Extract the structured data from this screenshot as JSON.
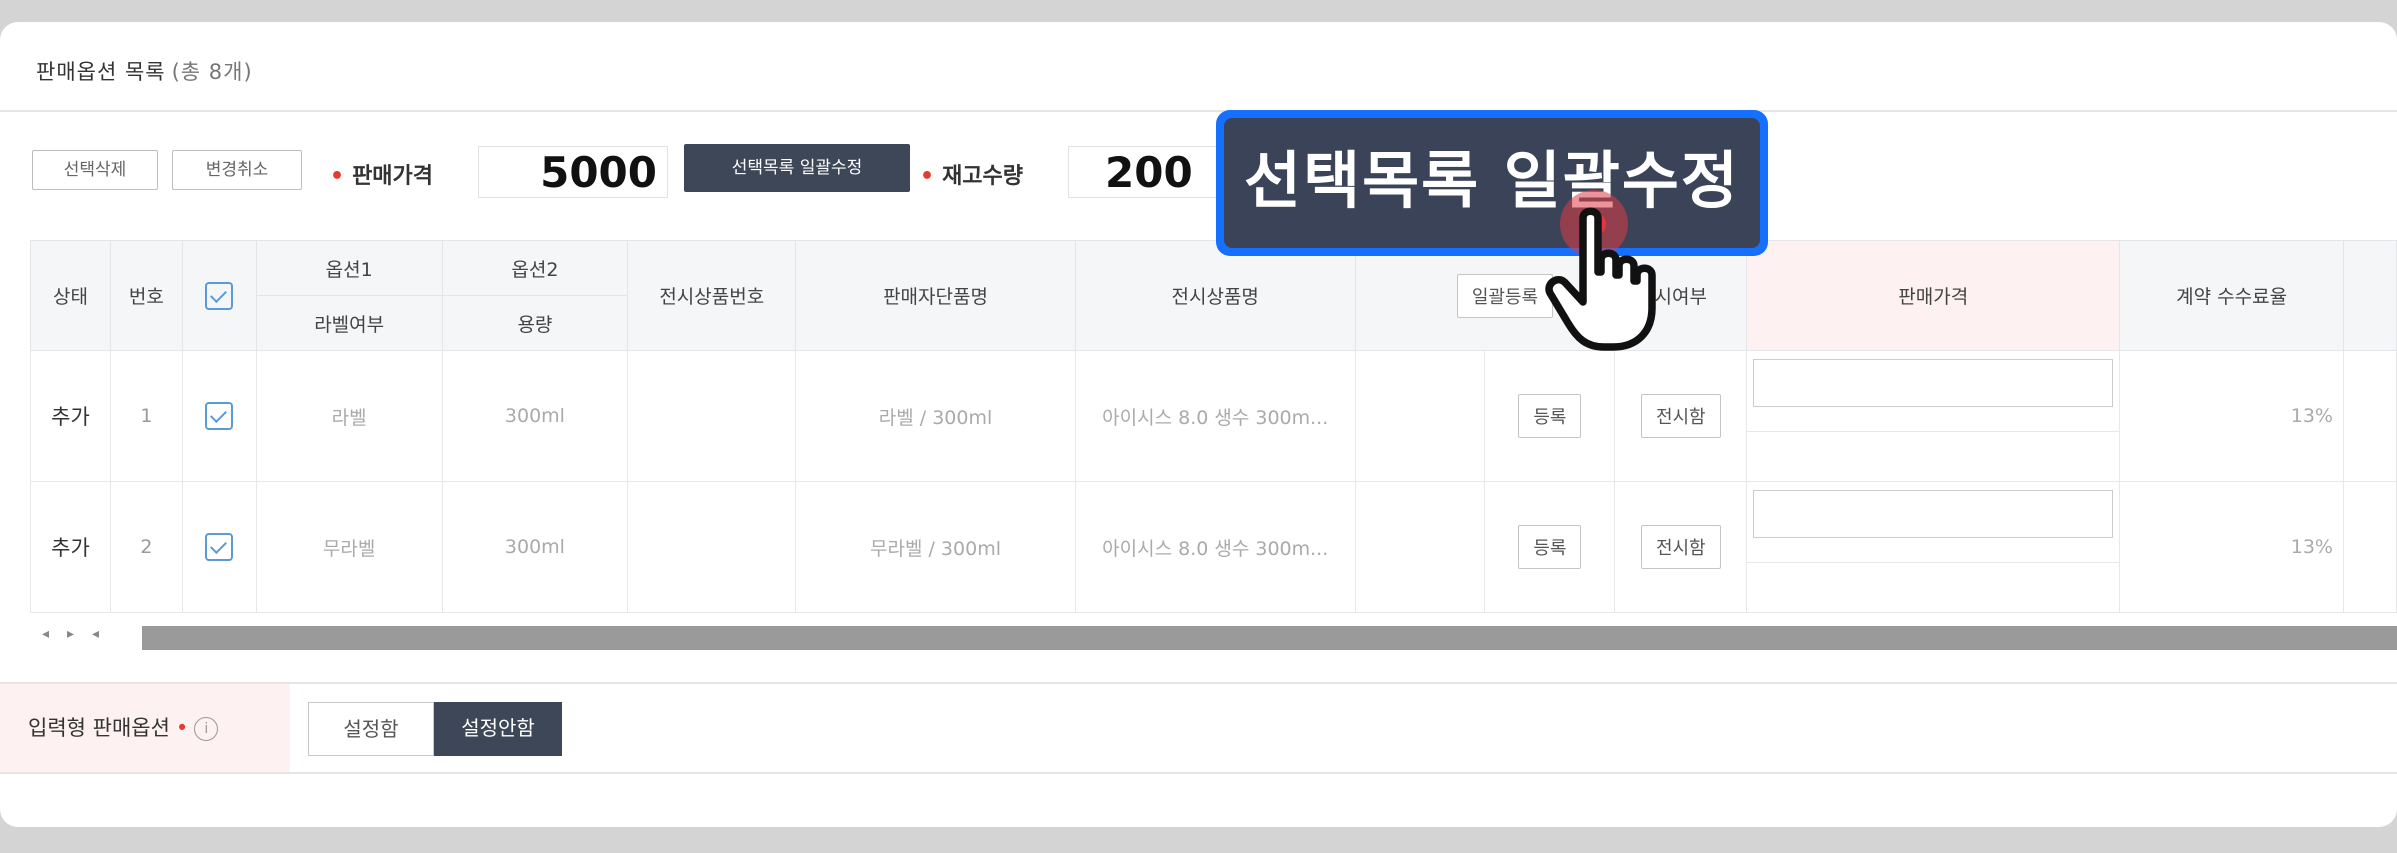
{
  "section": {
    "title": "판매옵션 목록",
    "count": "(총 8개)"
  },
  "toolbar": {
    "delete_selected": "선택삭제",
    "cancel_changes": "변경취소",
    "price_label": "판매가격",
    "price_value": "5000",
    "bulk_edit": "선택목록 일괄수정",
    "stock_label": "재고수량",
    "stock_value": "200"
  },
  "table": {
    "headers": {
      "status": "상태",
      "number": "번호",
      "option1": "옵션1",
      "option1_sub": "라벨여부",
      "option2": "옵션2",
      "option2_sub": "용량",
      "display_product_no": "전시상품번호",
      "seller_item_name": "판매자단품명",
      "display_product_name": "전시상품명",
      "bulk_register": "일괄등록",
      "display_status": "시여부",
      "sale_price": "판매가격",
      "commission_rate": "계약 수수료율"
    },
    "rows": [
      {
        "status": "추가",
        "number": "1",
        "option1": "라벨",
        "option2": "300ml",
        "seller_item": "라벨 / 300ml",
        "display_name": "아이시스 8.0 생수 300m...",
        "register": "등록",
        "display": "전시함",
        "commission": "13%"
      },
      {
        "status": "추가",
        "number": "2",
        "option1": "무라벨",
        "option2": "300ml",
        "seller_item": "무라벨 / 300ml",
        "display_name": "아이시스 8.0 생수 300m...",
        "register": "등록",
        "display": "전시함",
        "commission": "13%"
      }
    ]
  },
  "input_option": {
    "label": "입력형 판매옵션",
    "info": "i",
    "set_on": "설정함",
    "set_off": "설정안함",
    "selected": "설정안함"
  },
  "callout": {
    "text": "선택목록 일괄수정"
  },
  "colors": {
    "accent": "#1570ff",
    "dark_button": "#3d4758",
    "required_dot": "#e8392c",
    "checkbox": "#5b9bd5"
  },
  "icons": {
    "checkbox": "checkbox-checked-icon",
    "info": "info-circle-icon",
    "cursor": "pointer-hand-icon"
  }
}
